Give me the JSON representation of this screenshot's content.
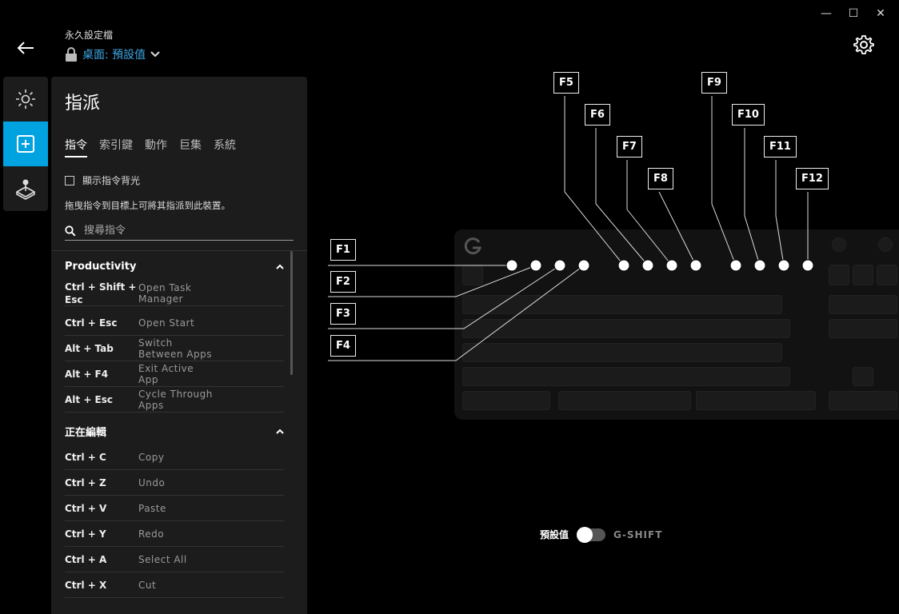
{
  "window": {
    "minimize": "—",
    "maximize": "☐",
    "close": "✕"
  },
  "header": {
    "profile_label": "永久設定檔",
    "profile_value": "桌面: 預設值"
  },
  "panel": {
    "title": "指派",
    "tabs": [
      "指令",
      "索引鍵",
      "動作",
      "巨集",
      "系統"
    ],
    "checkbox_label": "顯示指令背光",
    "hint": "拖曳指令到目標上可將其指派到此裝置。",
    "search_placeholder": "搜尋指令",
    "sections": [
      {
        "title": "Productivity",
        "rows": [
          {
            "keys": "Ctrl + Shift + Esc",
            "action": "Open Task Manager"
          },
          {
            "keys": "Ctrl + Esc",
            "action": "Open Start"
          },
          {
            "keys": "Alt + Tab",
            "action": "Switch Between Apps"
          },
          {
            "keys": "Alt + F4",
            "action": "Exit Active App"
          },
          {
            "keys": "Alt + Esc",
            "action": "Cycle Through Apps"
          }
        ]
      },
      {
        "title": "正在編輯",
        "rows": [
          {
            "keys": "Ctrl + C",
            "action": "Copy"
          },
          {
            "keys": "Ctrl + Z",
            "action": "Undo"
          },
          {
            "keys": "Ctrl + V",
            "action": "Paste"
          },
          {
            "keys": "Ctrl + Y",
            "action": "Redo"
          },
          {
            "keys": "Ctrl + A",
            "action": "Select All"
          },
          {
            "keys": "Ctrl + X",
            "action": "Cut"
          }
        ]
      }
    ]
  },
  "callouts": [
    "F1",
    "F2",
    "F3",
    "F4",
    "F5",
    "F6",
    "F7",
    "F8",
    "F9",
    "F10",
    "F11",
    "F12"
  ],
  "toggle": {
    "left_label": "預設值",
    "right_label": "G-SHIFT",
    "state": "default"
  },
  "colors": {
    "accent": "#00a3e0",
    "link": "#3ea7e6",
    "panel": "#1c1c1c"
  },
  "icons": {
    "back": "arrow-left-icon",
    "lock": "lock-icon",
    "chevron": "chevron-down-icon",
    "settings": "gear-icon",
    "lighting": "sun-icon",
    "assign": "plus-square-icon",
    "game_mode": "joystick-icon",
    "search": "search-icon"
  }
}
